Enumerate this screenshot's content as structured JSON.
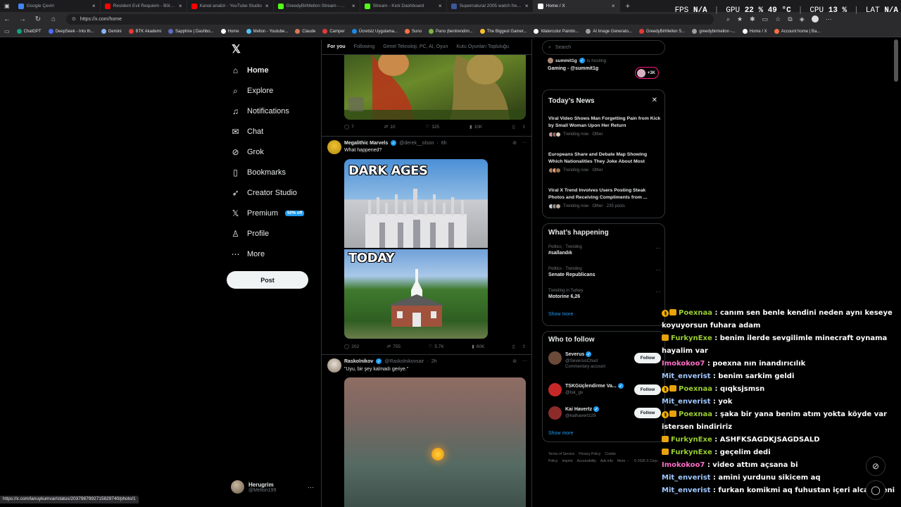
{
  "browser": {
    "tabs": [
      {
        "title": "Google Çeviri",
        "color": "#4285f4",
        "active": false
      },
      {
        "title": "Resident Evil Requiem - Bölüm 5",
        "color": "#ff0000",
        "active": false
      },
      {
        "title": "Kanal analizi - YouTube Studio",
        "color": "#ff0000",
        "active": false
      },
      {
        "title": "GreedyBirMellon Stream - Watch",
        "color": "#53fc18",
        "active": false
      },
      {
        "title": "Stream - Kick Dashboard",
        "color": "#53fc18",
        "active": false
      },
      {
        "title": "Supernatural 2005 watch free - 1",
        "color": "#3b5998",
        "active": false
      },
      {
        "title": "Home / X",
        "color": "#ffffff",
        "active": true
      }
    ],
    "url": "https://x.com/home",
    "status_url": "https://x.com/lanuykumvar/status/2037987992715829740/photo/1",
    "bookmarks": [
      {
        "label": "ChatGPT",
        "color": "#10a37f"
      },
      {
        "label": "DeepSeek - Into th...",
        "color": "#4d6bfe"
      },
      {
        "label": "Gemini",
        "color": "#8ab4f8"
      },
      {
        "label": "BTK Akademi",
        "color": "#e53935"
      },
      {
        "label": "Sapphire | Dashbo...",
        "color": "#5c6bc0"
      },
      {
        "label": "Home",
        "color": "#ffffff"
      },
      {
        "label": "Mellon - Youtube...",
        "color": "#4fc3f7"
      },
      {
        "label": "Claude",
        "color": "#d97757"
      },
      {
        "label": "Camper",
        "color": "#e53935"
      },
      {
        "label": "Ücretsiz Uygulama...",
        "color": "#1e88e5"
      },
      {
        "label": "Suno",
        "color": "#ff7043"
      },
      {
        "label": "Pano (bentrendim...",
        "color": "#7cb342"
      },
      {
        "label": "The Biggest Gamer...",
        "color": "#fbc02d"
      },
      {
        "label": "Watercolor Paintin...",
        "color": "#ffffff"
      },
      {
        "label": "AI Image Generato...",
        "color": "#9e9e9e"
      },
      {
        "label": "GreedyBirMellon S...",
        "color": "#e53935"
      },
      {
        "label": "greedybirmellon -...",
        "color": "#9e9e9e"
      },
      {
        "label": "Home / X",
        "color": "#ffffff"
      },
      {
        "label": "Account home | Ba...",
        "color": "#ff7043"
      }
    ]
  },
  "hud": {
    "fps_label": "FPS",
    "fps": "N/A",
    "gpu_label": "GPU",
    "gpu": "22 %  49 °C",
    "cpu_label": "CPU",
    "cpu": "13 %",
    "lat_label": "LAT",
    "lat": "N/A"
  },
  "nav": {
    "logo": "𝕏",
    "items": [
      {
        "label": "Home",
        "icon": "home-icon",
        "glyph": "⌂"
      },
      {
        "label": "Explore",
        "icon": "search-icon",
        "glyph": "⌕"
      },
      {
        "label": "Notifications",
        "icon": "bell-icon",
        "glyph": "♫"
      },
      {
        "label": "Chat",
        "icon": "mail-icon",
        "glyph": "✉"
      },
      {
        "label": "Grok",
        "icon": "grok-icon",
        "glyph": "⊘"
      },
      {
        "label": "Bookmarks",
        "icon": "bookmark-icon",
        "glyph": "▯"
      },
      {
        "label": "Creator Studio",
        "icon": "rocket-icon",
        "glyph": "➶"
      },
      {
        "label": "Premium",
        "icon": "x-premium-icon",
        "glyph": "𝕏"
      },
      {
        "label": "Profile",
        "icon": "person-icon",
        "glyph": "♙"
      },
      {
        "label": "More",
        "icon": "more-circle-icon",
        "glyph": "⋯"
      }
    ],
    "premium_badge": "50% off",
    "post_label": "Post",
    "account": {
      "name": "Herugrim",
      "handle": "@Mellon199"
    }
  },
  "feed": {
    "tabs": [
      "For you",
      "Following",
      "Genel Teknoloji, PC, AI, Oyun",
      "Kutu Oyunları Topluluğu"
    ],
    "top_actions": {
      "replies": "7",
      "reposts": "10",
      "likes": "325",
      "views": "10K"
    },
    "tweet1": {
      "name": "Megalithic Marvels",
      "handle": "@derek__olson",
      "time": "6h",
      "text": "What happened?",
      "caption_top": "DARK AGES",
      "caption_bottom": "TODAY",
      "actions": {
        "replies": "202",
        "reposts": "755",
        "likes": "5.7K",
        "views": "60K"
      }
    },
    "tweet2": {
      "name": "Raskolnikov",
      "handle": "@Raskolnikovsair",
      "time": "2h",
      "text": "\"Uyu, bir şey kalmadı geriye.\""
    }
  },
  "right": {
    "search_placeholder": "Search",
    "host": {
      "name": "summit1g",
      "status": "is hosting",
      "title": "Gaming - @summit1g",
      "count": "+3K"
    },
    "news": {
      "title": "Today’s News",
      "items": [
        {
          "title": "Viral Video Shows Man Forgetting Pain from Kick by Small Woman Upon Her Return",
          "meta": "Trending now · Other"
        },
        {
          "title": "Europeans Share and Debate Map Showing Which Nationalities They Joke About Most",
          "meta": "Trending now · Other"
        },
        {
          "title": "Viral X Trend Involves Users Posting Steak Photos and Receiving Compliments from ...",
          "meta": "Trending now · Other · 235 posts"
        }
      ]
    },
    "happening": {
      "title": "What’s happening",
      "items": [
        {
          "context": "Politics · Trending",
          "name": "#sallandık"
        },
        {
          "context": "Politics · Trending",
          "name": "Senate Republicans"
        },
        {
          "context": "Trending in Turkey",
          "name": "Motorine 6,26"
        }
      ],
      "show_more": "Show more"
    },
    "who_to_follow": {
      "title": "Who to follow",
      "items": [
        {
          "name": "Severus",
          "handle": "@SeverusChud",
          "extra": "Commentary account",
          "avatar": "#6b4a3a"
        },
        {
          "name": "TSKGüçlendirme Va...",
          "handle": "@tsk_gv",
          "extra": "",
          "avatar": "#c62828"
        },
        {
          "name": "Kai Havertz",
          "handle": "@kaihavertz29",
          "extra": "",
          "avatar": "#8d2b2b"
        }
      ],
      "follow_label": "Follow",
      "show_more": "Show more"
    },
    "footer": [
      "Terms of Service",
      "Privacy Policy",
      "Cookie Policy",
      "Imprint",
      "Accessibility",
      "Ads info",
      "More ···",
      "© 2026 X Corp."
    ]
  },
  "chat": [
    {
      "badges": 2,
      "user": "Poexnaa",
      "color": "#9acd32",
      "msg": " : canım sen benle kendini neden aynı keseye koyuyorsun fuhara adam"
    },
    {
      "badges": 1,
      "user": "FurkynExe",
      "color": "#9acd32",
      "msg": " : benim ilerde sevgilimle minecraft oynama hayalim var"
    },
    {
      "badges": 0,
      "user": "Imokokoo7",
      "color": "#ff6ec7",
      "msg": " : poexna nın inandırıcılık"
    },
    {
      "badges": 0,
      "user": "Mit_enverist",
      "color": "#a0c8ff",
      "msg": " : benim sarkim geldi"
    },
    {
      "badges": 2,
      "user": "Poexnaa",
      "color": "#9acd32",
      "msg": " : qıqksjsmsn"
    },
    {
      "badges": 0,
      "user": "Mit_enverist",
      "color": "#a0c8ff",
      "msg": " : yok"
    },
    {
      "badges": 2,
      "user": "Poexnaa",
      "color": "#9acd32",
      "msg": " : şaka bir yana benim atım yokta köyde var istersen bindiririz"
    },
    {
      "badges": 1,
      "user": "FurkynExe",
      "color": "#9acd32",
      "msg": " : ASHFKSAGDKJSAGDSALD"
    },
    {
      "badges": 1,
      "user": "FurkynExe",
      "color": "#9acd32",
      "msg": " : geçelim dedi"
    },
    {
      "badges": 0,
      "user": "Imokokoo7",
      "color": "#ff6ec7",
      "msg": " : video attım açsana bi"
    },
    {
      "badges": 0,
      "user": "Mit_enverist",
      "color": "#a0c8ff",
      "msg": " : amini yurdunu sikicem aq"
    },
    {
      "badges": 0,
      "user": "Mit_enverist",
      "color": "#a0c8ff",
      "msg": " : furkan komikmi aq fuhustan içeri alcam seni"
    }
  ]
}
